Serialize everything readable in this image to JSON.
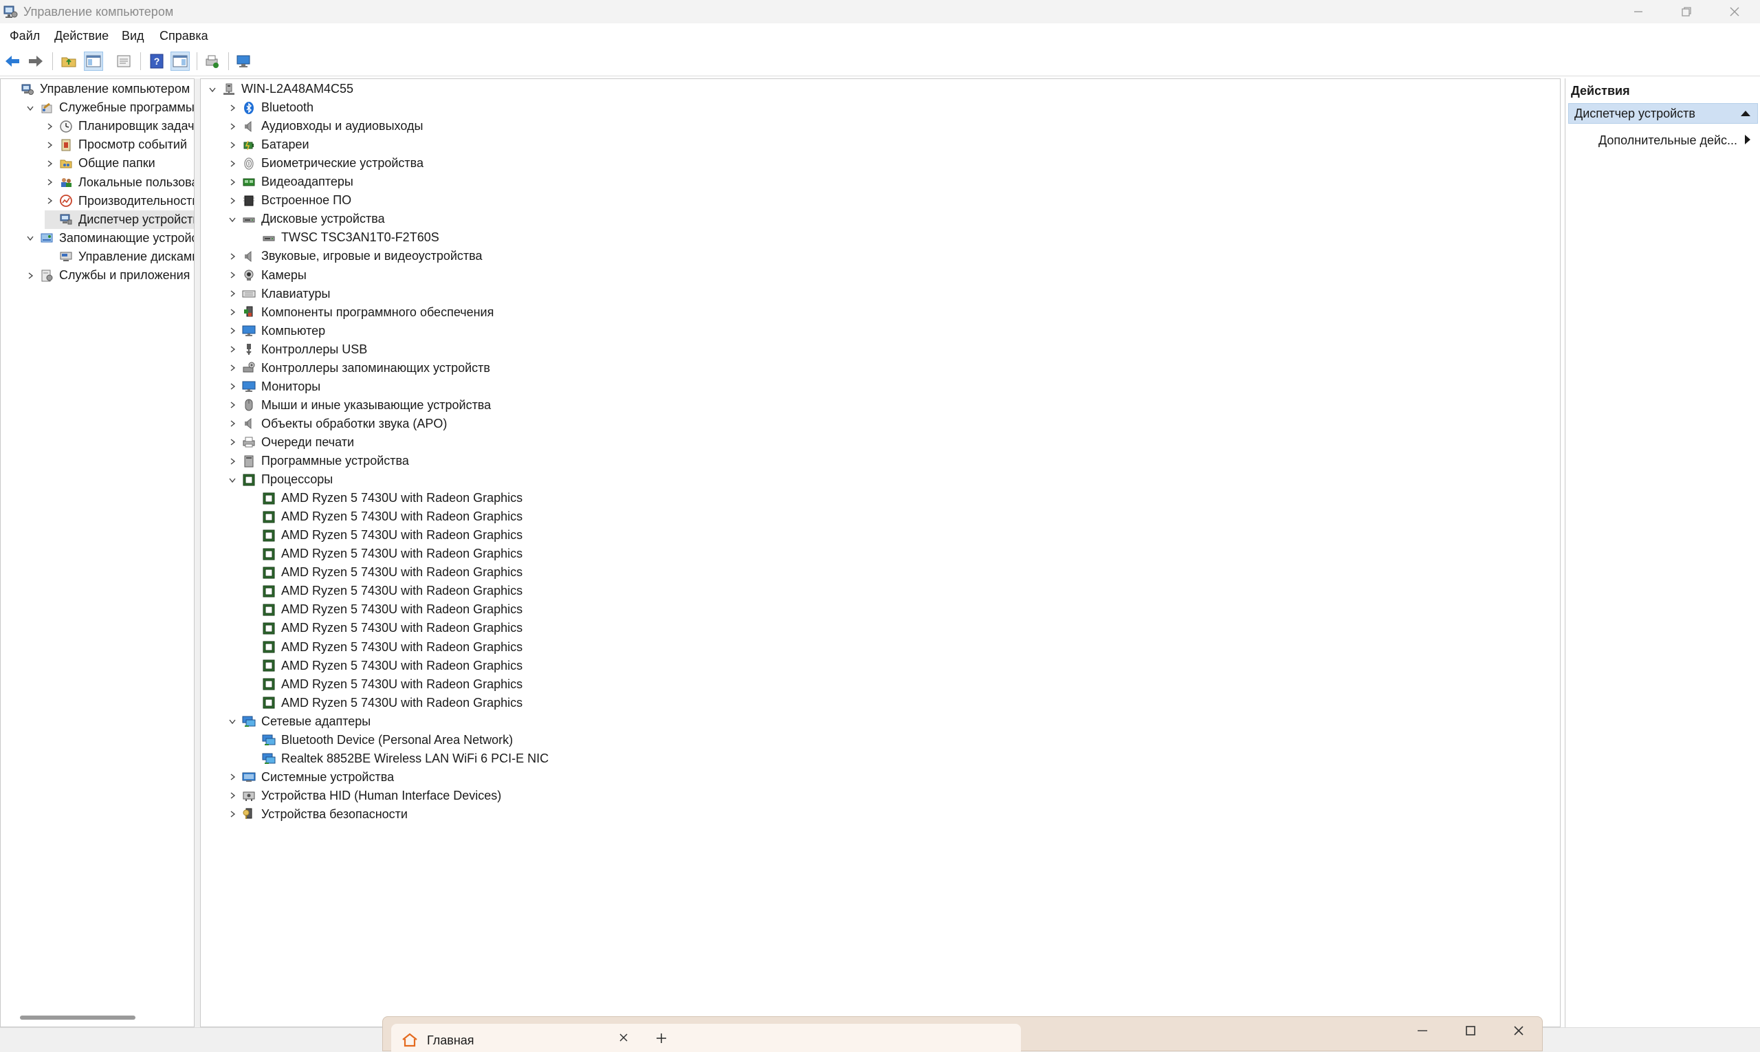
{
  "window": {
    "title": "Управление компьютером"
  },
  "menu": [
    "Файл",
    "Действие",
    "Вид",
    "Справка"
  ],
  "toolbar": {
    "icons": [
      "back-arrow-icon",
      "forward-arrow-icon",
      "up-folder-icon",
      "show-hide-tree-icon",
      "properties-icon",
      "help-icon",
      "action-pane-icon",
      "print-icon",
      "monitor-icon"
    ],
    "active": [
      "show-hide-tree-icon",
      "action-pane-icon"
    ]
  },
  "left_tree": [
    {
      "label": "Управление компьютером (лс",
      "level": 0,
      "chevron": "none",
      "icon": "computer-management-icon"
    },
    {
      "label": "Служебные программы",
      "level": 1,
      "chevron": "down",
      "icon": "tools-icon"
    },
    {
      "label": "Планировщик задач",
      "level": 2,
      "chevron": "right",
      "icon": "clock-icon"
    },
    {
      "label": "Просмотр событий",
      "level": 2,
      "chevron": "right",
      "icon": "event-log-icon"
    },
    {
      "label": "Общие папки",
      "level": 2,
      "chevron": "right",
      "icon": "shared-folder-icon"
    },
    {
      "label": "Локальные пользовате",
      "level": 2,
      "chevron": "right",
      "icon": "users-icon"
    },
    {
      "label": "Производительность",
      "level": 2,
      "chevron": "right",
      "icon": "performance-icon"
    },
    {
      "label": "Диспетчер устройств",
      "level": 2,
      "chevron": "none",
      "icon": "device-manager-icon",
      "selected": true
    },
    {
      "label": "Запоминающие устройств",
      "level": 1,
      "chevron": "down",
      "icon": "storage-icon"
    },
    {
      "label": "Управление дисками",
      "level": 2,
      "chevron": "none",
      "icon": "disk-management-icon"
    },
    {
      "label": "Службы и приложения",
      "level": 1,
      "chevron": "right",
      "icon": "services-icon"
    }
  ],
  "device_tree": [
    {
      "label": "WIN-L2A48AM4C55",
      "level": 0,
      "chevron": "down",
      "icon": "computer-icon"
    },
    {
      "label": "Bluetooth",
      "level": 1,
      "chevron": "right",
      "icon": "bluetooth-icon"
    },
    {
      "label": "Аудиовходы и аудиовыходы",
      "level": 1,
      "chevron": "right",
      "icon": "speaker-icon"
    },
    {
      "label": "Батареи",
      "level": 1,
      "chevron": "right",
      "icon": "battery-icon"
    },
    {
      "label": "Биометрические устройства",
      "level": 1,
      "chevron": "right",
      "icon": "fingerprint-icon"
    },
    {
      "label": "Видеоадаптеры",
      "level": 1,
      "chevron": "right",
      "icon": "display-adapter-icon"
    },
    {
      "label": "Встроенное ПО",
      "level": 1,
      "chevron": "right",
      "icon": "firmware-icon"
    },
    {
      "label": "Дисковые устройства",
      "level": 1,
      "chevron": "down",
      "icon": "disk-drive-icon"
    },
    {
      "label": "TWSC TSC3AN1T0-F2T60S",
      "level": 2,
      "chevron": "none",
      "icon": "disk-drive-icon"
    },
    {
      "label": "Звуковые, игровые и видеоустройства",
      "level": 1,
      "chevron": "right",
      "icon": "speaker-icon"
    },
    {
      "label": "Камеры",
      "level": 1,
      "chevron": "right",
      "icon": "camera-icon"
    },
    {
      "label": "Клавиатуры",
      "level": 1,
      "chevron": "right",
      "icon": "keyboard-icon"
    },
    {
      "label": "Компоненты программного обеспечения",
      "level": 1,
      "chevron": "right",
      "icon": "software-component-icon"
    },
    {
      "label": "Компьютер",
      "level": 1,
      "chevron": "right",
      "icon": "monitor-icon"
    },
    {
      "label": "Контроллеры USB",
      "level": 1,
      "chevron": "right",
      "icon": "usb-icon"
    },
    {
      "label": "Контроллеры запоминающих устройств",
      "level": 1,
      "chevron": "right",
      "icon": "storage-controller-icon"
    },
    {
      "label": "Мониторы",
      "level": 1,
      "chevron": "right",
      "icon": "monitor-icon"
    },
    {
      "label": "Мыши и иные указывающие устройства",
      "level": 1,
      "chevron": "right",
      "icon": "mouse-icon"
    },
    {
      "label": "Объекты обработки звука (APO)",
      "level": 1,
      "chevron": "right",
      "icon": "speaker-icon"
    },
    {
      "label": "Очереди печати",
      "level": 1,
      "chevron": "right",
      "icon": "printer-icon"
    },
    {
      "label": "Программные устройства",
      "level": 1,
      "chevron": "right",
      "icon": "software-device-icon"
    },
    {
      "label": "Процессоры",
      "level": 1,
      "chevron": "down",
      "icon": "processor-icon"
    },
    {
      "label": "AMD Ryzen 5 7430U with Radeon Graphics",
      "level": 2,
      "chevron": "none",
      "icon": "processor-icon"
    },
    {
      "label": "AMD Ryzen 5 7430U with Radeon Graphics",
      "level": 2,
      "chevron": "none",
      "icon": "processor-icon"
    },
    {
      "label": "AMD Ryzen 5 7430U with Radeon Graphics",
      "level": 2,
      "chevron": "none",
      "icon": "processor-icon"
    },
    {
      "label": "AMD Ryzen 5 7430U with Radeon Graphics",
      "level": 2,
      "chevron": "none",
      "icon": "processor-icon"
    },
    {
      "label": "AMD Ryzen 5 7430U with Radeon Graphics",
      "level": 2,
      "chevron": "none",
      "icon": "processor-icon"
    },
    {
      "label": "AMD Ryzen 5 7430U with Radeon Graphics",
      "level": 2,
      "chevron": "none",
      "icon": "processor-icon"
    },
    {
      "label": "AMD Ryzen 5 7430U with Radeon Graphics",
      "level": 2,
      "chevron": "none",
      "icon": "processor-icon"
    },
    {
      "label": "AMD Ryzen 5 7430U with Radeon Graphics",
      "level": 2,
      "chevron": "none",
      "icon": "processor-icon"
    },
    {
      "label": "AMD Ryzen 5 7430U with Radeon Graphics",
      "level": 2,
      "chevron": "none",
      "icon": "processor-icon"
    },
    {
      "label": "AMD Ryzen 5 7430U with Radeon Graphics",
      "level": 2,
      "chevron": "none",
      "icon": "processor-icon"
    },
    {
      "label": "AMD Ryzen 5 7430U with Radeon Graphics",
      "level": 2,
      "chevron": "none",
      "icon": "processor-icon"
    },
    {
      "label": "AMD Ryzen 5 7430U with Radeon Graphics",
      "level": 2,
      "chevron": "none",
      "icon": "processor-icon"
    },
    {
      "label": "Сетевые адаптеры",
      "level": 1,
      "chevron": "down",
      "icon": "network-adapter-icon"
    },
    {
      "label": "Bluetooth Device (Personal Area Network)",
      "level": 2,
      "chevron": "none",
      "icon": "network-adapter-icon"
    },
    {
      "label": "Realtek 8852BE Wireless LAN WiFi 6 PCI-E NIC",
      "level": 2,
      "chevron": "none",
      "icon": "network-adapter-icon"
    },
    {
      "label": "Системные устройства",
      "level": 1,
      "chevron": "right",
      "icon": "system-device-icon"
    },
    {
      "label": "Устройства HID (Human Interface Devices)",
      "level": 1,
      "chevron": "right",
      "icon": "hid-icon"
    },
    {
      "label": "Устройства безопасности",
      "level": 1,
      "chevron": "right",
      "icon": "security-device-icon"
    }
  ],
  "actions": {
    "header": "Действия",
    "section": "Диспетчер устройств",
    "item": "Дополнительные дейс..."
  },
  "browser": {
    "tab_label": "Главная"
  },
  "colors": {
    "selection_band": "#cfe0f3",
    "title_text": "#8a8a8a",
    "browser_frame": "#ede0d4"
  }
}
